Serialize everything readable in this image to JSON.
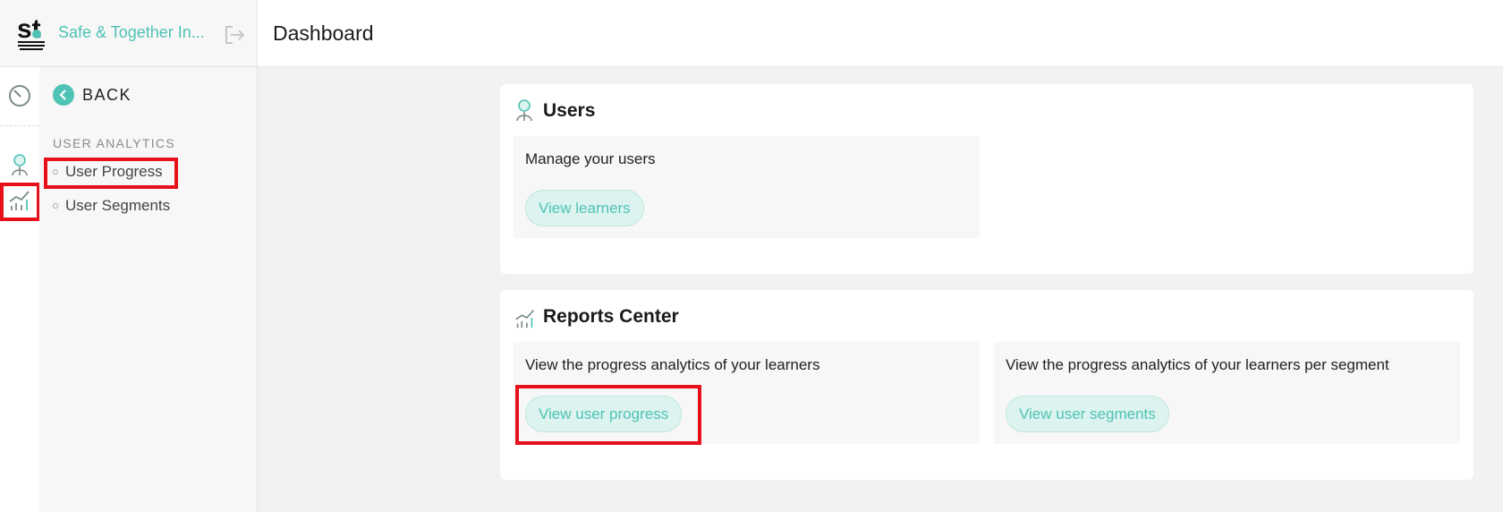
{
  "app": {
    "brand_name": "Safe & Together In...",
    "logo_text": "st"
  },
  "sidebar": {
    "back_label": "BACK",
    "section_title": "USER ANALYTICS",
    "items": [
      {
        "label": "User Progress",
        "highlighted": true
      },
      {
        "label": "User Segments",
        "highlighted": false
      }
    ]
  },
  "rail": {
    "icons": [
      "dashboard-gauge-icon",
      "user-icon",
      "analytics-chart-icon"
    ],
    "active": "analytics-chart-icon"
  },
  "header": {
    "title": "Dashboard"
  },
  "cards": {
    "users": {
      "title": "Users",
      "icon": "user-icon",
      "tiles": [
        {
          "text": "Manage your users",
          "button": "View learners"
        }
      ]
    },
    "reports": {
      "title": "Reports Center",
      "icon": "analytics-chart-icon",
      "tiles": [
        {
          "text": "View the progress analytics of your learners",
          "button": "View user progress",
          "highlighted": true
        },
        {
          "text": "View the progress analytics of your learners per segment",
          "button": "View user segments"
        }
      ]
    }
  },
  "colors": {
    "accent": "#4fc3b5",
    "highlight": "#e8111b",
    "pill_bg": "#dcf3ef",
    "tile_bg": "#f7f7f7",
    "page_bg": "#f2f2f2"
  }
}
